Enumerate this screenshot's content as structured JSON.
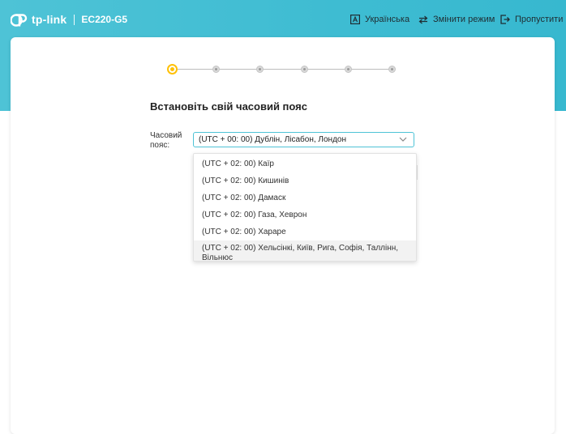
{
  "brand": {
    "logo_text": "tp-link",
    "model": "EC220-G5"
  },
  "nav": {
    "language": "Українська",
    "change_mode": "Змінити режим",
    "skip": "Пропустити"
  },
  "stepper": {
    "total_steps": 6,
    "current_step": 1
  },
  "page": {
    "title": "Встановіть свій часовий пояс"
  },
  "timezone": {
    "label": "Часовий пояс:",
    "selected": "(UTC + 00: 00) Дублін, Лісабон, Лондон",
    "options": [
      "(UTC + 02: 00) Каїр",
      "(UTC + 02: 00) Кишинів",
      "(UTC + 02: 00) Дамаск",
      "(UTC + 02: 00) Газа, Хеврон",
      "(UTC + 02: 00) Хараре",
      "(UTC + 02: 00) Хельсінкі, Київ, Рига, Софія, Таллінн, Вільнюс"
    ]
  },
  "colors": {
    "brand_teal": "#4ec3d6",
    "step_active": "#ffc107"
  }
}
